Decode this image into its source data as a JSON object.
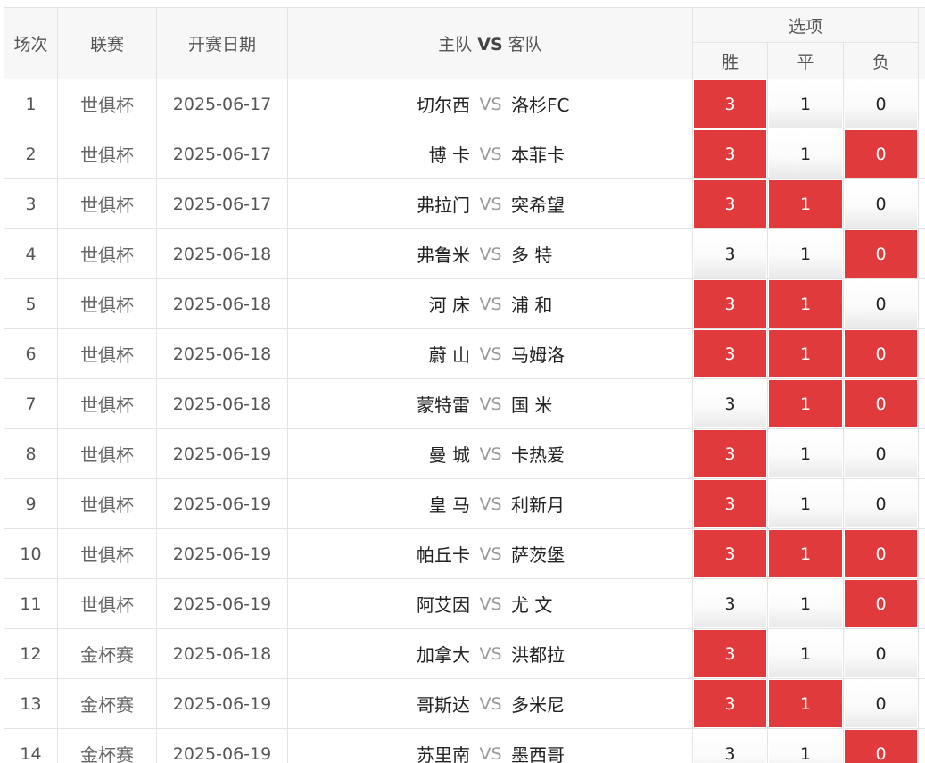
{
  "header": {
    "col_index": "场次",
    "col_league": "联赛",
    "col_date": "开赛日期",
    "col_home": "主队",
    "col_vs": "VS",
    "col_away": "客队",
    "col_options": "选项",
    "opt_win": "胜",
    "opt_draw": "平",
    "opt_lose": "负"
  },
  "accent_color": "#e03a3d",
  "vs_text": "VS",
  "rows": [
    {
      "idx": "1",
      "league": "世俱杯",
      "date": "2025-06-17",
      "home": "切尔西",
      "away": "洛杉FC",
      "win": "3",
      "draw": "1",
      "lose": "0",
      "sel": [
        true,
        false,
        false
      ]
    },
    {
      "idx": "2",
      "league": "世俱杯",
      "date": "2025-06-17",
      "home": "博 卡",
      "away": "本菲卡",
      "win": "3",
      "draw": "1",
      "lose": "0",
      "sel": [
        true,
        false,
        true
      ]
    },
    {
      "idx": "3",
      "league": "世俱杯",
      "date": "2025-06-17",
      "home": "弗拉门",
      "away": "突希望",
      "win": "3",
      "draw": "1",
      "lose": "0",
      "sel": [
        true,
        true,
        false
      ]
    },
    {
      "idx": "4",
      "league": "世俱杯",
      "date": "2025-06-18",
      "home": "弗鲁米",
      "away": "多 特",
      "win": "3",
      "draw": "1",
      "lose": "0",
      "sel": [
        false,
        false,
        true
      ]
    },
    {
      "idx": "5",
      "league": "世俱杯",
      "date": "2025-06-18",
      "home": "河 床",
      "away": "浦 和",
      "win": "3",
      "draw": "1",
      "lose": "0",
      "sel": [
        true,
        true,
        false
      ]
    },
    {
      "idx": "6",
      "league": "世俱杯",
      "date": "2025-06-18",
      "home": "蔚 山",
      "away": "马姆洛",
      "win": "3",
      "draw": "1",
      "lose": "0",
      "sel": [
        true,
        true,
        true
      ]
    },
    {
      "idx": "7",
      "league": "世俱杯",
      "date": "2025-06-18",
      "home": "蒙特雷",
      "away": "国 米",
      "win": "3",
      "draw": "1",
      "lose": "0",
      "sel": [
        false,
        true,
        true
      ]
    },
    {
      "idx": "8",
      "league": "世俱杯",
      "date": "2025-06-19",
      "home": "曼 城",
      "away": "卡热爱",
      "win": "3",
      "draw": "1",
      "lose": "0",
      "sel": [
        true,
        false,
        false
      ]
    },
    {
      "idx": "9",
      "league": "世俱杯",
      "date": "2025-06-19",
      "home": "皇 马",
      "away": "利新月",
      "win": "3",
      "draw": "1",
      "lose": "0",
      "sel": [
        true,
        false,
        false
      ]
    },
    {
      "idx": "10",
      "league": "世俱杯",
      "date": "2025-06-19",
      "home": "帕丘卡",
      "away": "萨茨堡",
      "win": "3",
      "draw": "1",
      "lose": "0",
      "sel": [
        true,
        true,
        true
      ]
    },
    {
      "idx": "11",
      "league": "世俱杯",
      "date": "2025-06-19",
      "home": "阿艾因",
      "away": "尤 文",
      "win": "3",
      "draw": "1",
      "lose": "0",
      "sel": [
        false,
        false,
        true
      ]
    },
    {
      "idx": "12",
      "league": "金杯赛",
      "date": "2025-06-18",
      "home": "加拿大",
      "away": "洪都拉",
      "win": "3",
      "draw": "1",
      "lose": "0",
      "sel": [
        true,
        false,
        false
      ]
    },
    {
      "idx": "13",
      "league": "金杯赛",
      "date": "2025-06-19",
      "home": "哥斯达",
      "away": "多米尼",
      "win": "3",
      "draw": "1",
      "lose": "0",
      "sel": [
        true,
        true,
        false
      ]
    },
    {
      "idx": "14",
      "league": "金杯赛",
      "date": "2025-06-19",
      "home": "苏里南",
      "away": "墨西哥",
      "win": "3",
      "draw": "1",
      "lose": "0",
      "sel": [
        false,
        false,
        true
      ]
    }
  ]
}
